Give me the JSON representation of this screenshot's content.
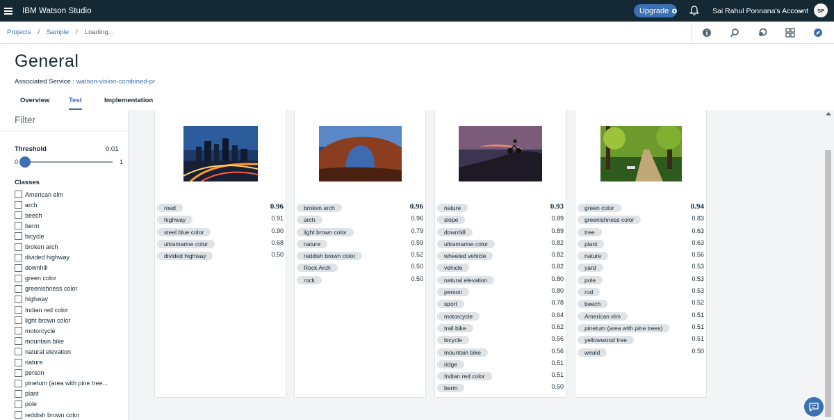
{
  "app": {
    "title": "IBM Watson Studio",
    "upgrade_label": "Upgrade",
    "account": "Sai Rahul Ponnana's Account",
    "avatar": "SP"
  },
  "breadcrumb": {
    "items": [
      "Projects",
      "Sample"
    ],
    "current": "Loading..."
  },
  "header": {
    "title": "General",
    "assoc_label": "Associated Service :",
    "assoc_link": "watson-vision-combined-pr"
  },
  "tabs": [
    {
      "label": "Overview"
    },
    {
      "label": "Test"
    },
    {
      "label": "Implementation"
    }
  ],
  "sidebar": {
    "filter": "Filter",
    "threshold_label": "Threshold",
    "threshold_value": "0.01",
    "slider_min": "0",
    "slider_max": "1",
    "classes_label": "Classes",
    "classes": [
      "American elm",
      "arch",
      "beech",
      "berm",
      "bicycle",
      "broken arch",
      "divided highway",
      "downhill",
      "green color",
      "greenishness color",
      "highway",
      "Indian red color",
      "light brown color",
      "motorcycle",
      "mountain bike",
      "natural elevation",
      "nature",
      "person",
      "pinetum (area with pine tree...",
      "plant",
      "pole",
      "reddish brown color"
    ]
  },
  "results": [
    {
      "image": "city-night-icon",
      "rows": [
        [
          "road",
          "0.96"
        ],
        [
          "highway",
          "0.91"
        ],
        [
          "steel blue color",
          "0.90"
        ],
        [
          "ultramarine color",
          "0.68"
        ],
        [
          "divided highway",
          "0.50"
        ]
      ]
    },
    {
      "image": "rock-arch-icon",
      "rows": [
        [
          "broken arch",
          "0.96"
        ],
        [
          "arch",
          "0.96"
        ],
        [
          "light brown color",
          "0.79"
        ],
        [
          "nature",
          "0.59"
        ],
        [
          "reddish brown color",
          "0.52"
        ],
        [
          "Rock Arch",
          "0.50"
        ],
        [
          "rock",
          "0.50"
        ]
      ]
    },
    {
      "image": "mountain-bike-icon",
      "rows": [
        [
          "nature",
          "0.93"
        ],
        [
          "slope",
          "0.89"
        ],
        [
          "downhill",
          "0.89"
        ],
        [
          "ultramarine color",
          "0.82"
        ],
        [
          "wheeled vehicle",
          "0.82"
        ],
        [
          "vehicle",
          "0.82"
        ],
        [
          "natural elevation",
          "0.80"
        ],
        [
          "person",
          "0.80"
        ],
        [
          "sport",
          "0.78"
        ],
        [
          "motorcycle",
          "0.64"
        ],
        [
          "trail bike",
          "0.62"
        ],
        [
          "bicycle",
          "0.56"
        ],
        [
          "mountain bike",
          "0.56"
        ],
        [
          "ridge",
          "0.51"
        ],
        [
          "Indian red color",
          "0.51"
        ],
        [
          "berm",
          "0.50"
        ]
      ]
    },
    {
      "image": "park-path-icon",
      "rows": [
        [
          "green color",
          "0.94"
        ],
        [
          "greenishness color",
          "0.83"
        ],
        [
          "tree",
          "0.63"
        ],
        [
          "plant",
          "0.63"
        ],
        [
          "nature",
          "0.56"
        ],
        [
          "yard",
          "0.53"
        ],
        [
          "pole",
          "0.53"
        ],
        [
          "rod",
          "0.53"
        ],
        [
          "beech",
          "0.52"
        ],
        [
          "American elm",
          "0.51"
        ],
        [
          "pinetum (area with pine trees)",
          "0.51"
        ],
        [
          "yellowwood tree",
          "0.51"
        ],
        [
          "weald",
          "0.50"
        ]
      ]
    }
  ]
}
